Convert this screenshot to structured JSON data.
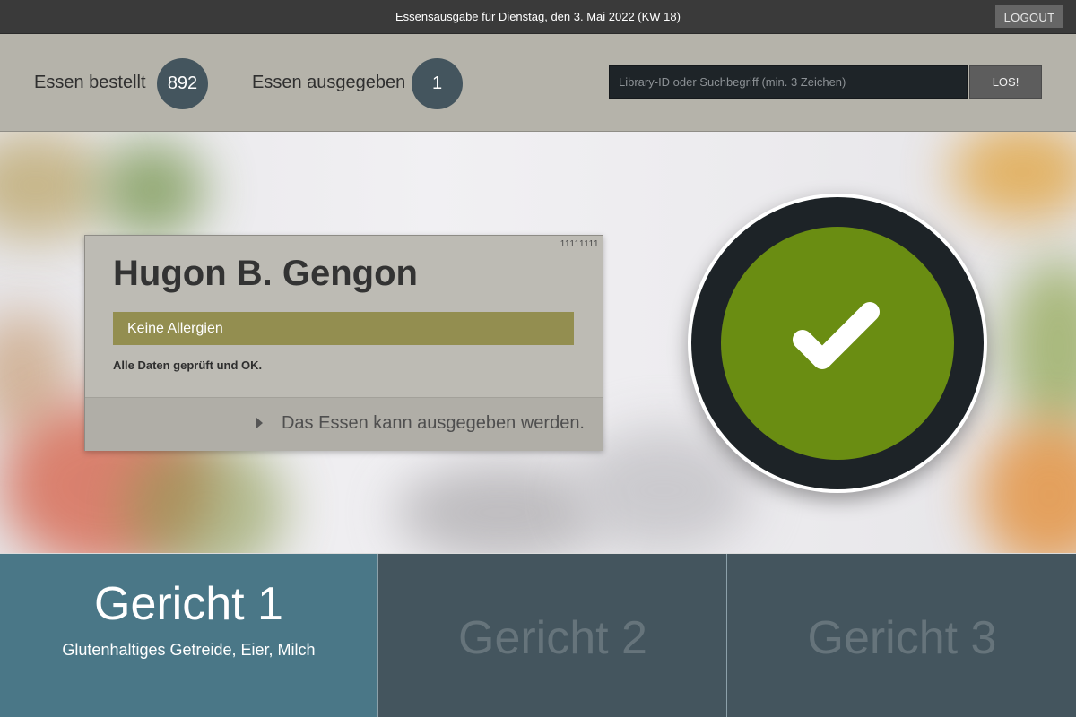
{
  "header": {
    "title": "Essensausgabe für Dienstag, den 3. Mai 2022 (KW 18)",
    "logout_label": "LOGOUT"
  },
  "stats": {
    "ordered_label": "Essen bestellt",
    "ordered_count": "892",
    "served_label": "Essen ausgegeben",
    "served_count": "1"
  },
  "search": {
    "placeholder": "Library-ID oder Suchbegriff (min. 3 Zeichen)",
    "value": "",
    "button_label": "LOS!"
  },
  "person": {
    "id": "11111111",
    "name": "Hugon B. Gengon",
    "allergy_status": "Keine Allergien",
    "check_message": "Alle Daten geprüft und OK.",
    "result_message": "Das Essen kann ausgegeben werden."
  },
  "status_indicator": {
    "icon": "checkmark-icon",
    "color": "#6a8d12"
  },
  "meals": [
    {
      "title": "Gericht 1",
      "allergens": "Glutenhaltiges Getreide, Eier, Milch",
      "selected": true
    },
    {
      "title": "Gericht 2",
      "allergens": "",
      "selected": false
    },
    {
      "title": "Gericht 3",
      "allergens": "",
      "selected": false
    }
  ],
  "colors": {
    "header_bg": "#3a3a3a",
    "stats_bg": "#b5b3aa",
    "count_circle": "#44555e",
    "allergy_bar": "#938e50",
    "meal_active": "#4a7787",
    "meal_inactive": "#44555e"
  }
}
